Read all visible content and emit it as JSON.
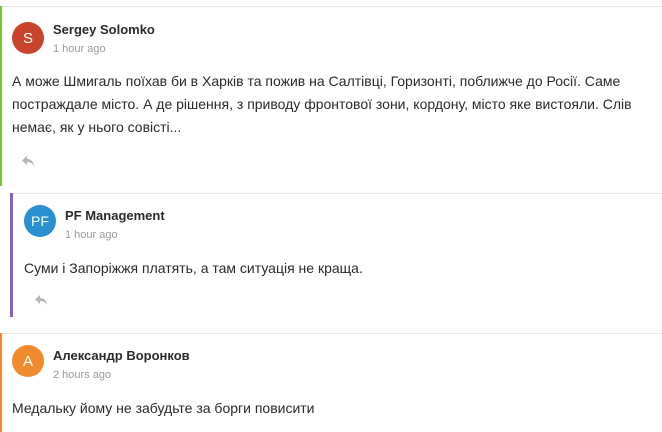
{
  "comments": [
    {
      "author": "Sergey Solomko",
      "initial": "S",
      "avatar_color": "#c8442b",
      "time": "1 hour ago",
      "text": "А може Шмигаль поїхав би в Харків та пожив на Салтівці, Горизонті, поближче до Росії. Саме постраждале місто. А де рішення, з приводу фронтової зони, кордону, місто яке вистояли. Слів немає, як у нього совісті...",
      "reply_icon": "reply-icon"
    },
    {
      "author": "PF Management",
      "initial": "PF",
      "avatar_color": "#2a8fd0",
      "time": "1 hour ago",
      "text": "Суми і Запоріжжя платять, а там ситуація не краща.",
      "reply_icon": "reply-icon"
    },
    {
      "author": "Александр Воронков",
      "initial": "А",
      "avatar_color": "#f08a2c",
      "time": "2 hours ago",
      "text": "Медальку йому не забудьте за борги повисити"
    }
  ],
  "colors": {
    "thread_green": "#7ac143",
    "thread_purple": "#8e5cc2",
    "thread_orange": "#f2893a"
  }
}
